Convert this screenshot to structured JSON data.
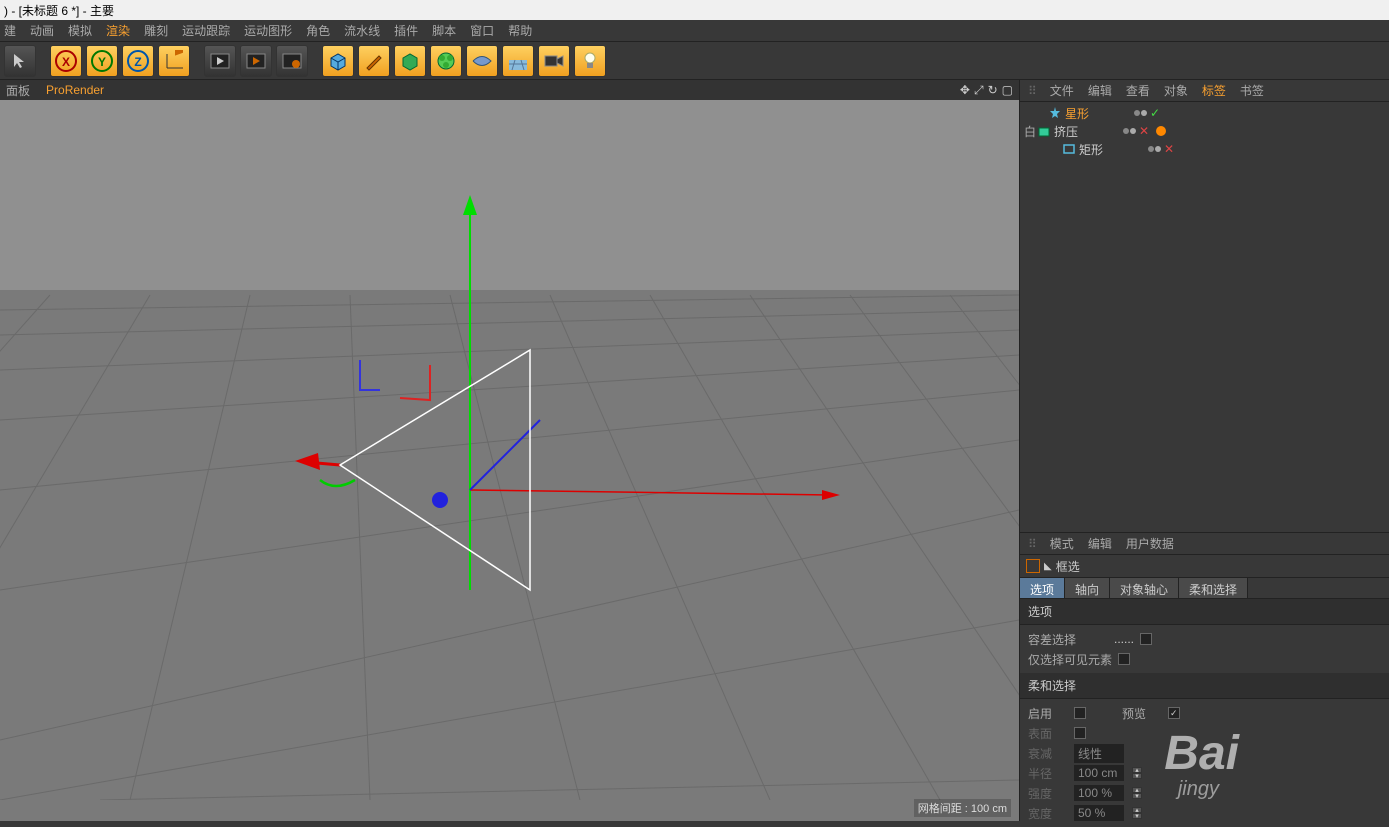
{
  "title": ") - [未标题 6 *] - 主要",
  "menu": [
    "建",
    "动画",
    "模拟",
    "渲染",
    "雕刻",
    "运动跟踪",
    "运动图形",
    "角色",
    "流水线",
    "插件",
    "脚本",
    "窗口",
    "帮助"
  ],
  "menu_hl": 3,
  "vphdr": {
    "panel": "面板",
    "pro": "ProRender"
  },
  "vpstatus": "网格间距 : 100 cm",
  "objmgr": {
    "menu": [
      "文件",
      "编辑",
      "查看",
      "对象",
      "标签",
      "书签"
    ],
    "menu_hl": 4,
    "rows": [
      {
        "indent": 0,
        "exp": "",
        "icon": "star",
        "name": "星形",
        "sel": true,
        "state": "ok",
        "tag": false
      },
      {
        "indent": 0,
        "exp": "白",
        "icon": "extrude",
        "name": "挤压",
        "sel": false,
        "state": "x",
        "tag": true
      },
      {
        "indent": 1,
        "exp": "",
        "icon": "rect",
        "name": "矩形",
        "sel": false,
        "state": "x",
        "tag": false
      }
    ]
  },
  "attrmgr": {
    "menu": [
      "模式",
      "编辑",
      "用户数据"
    ],
    "tool": "框选",
    "tabs": [
      "选项",
      "轴向",
      "对象轴心",
      "柔和选择"
    ],
    "tab_active": 0,
    "sect1": "选项",
    "p_tolerance": "容差选择",
    "p_visible": "仅选择可见元素",
    "sect2": "柔和选择",
    "p_enable": "启用",
    "p_preview": "预览",
    "p_surface": "表面",
    "p_falloff": "衰减",
    "p_falloff_v": "线性",
    "p_radius": "半径",
    "p_radius_v": "100 cm",
    "p_strength": "强度",
    "p_strength_v": "100 %",
    "p_width": "宽度",
    "p_width_v": "50 %"
  },
  "watermark1": "Bai",
  "watermark2": "jingy"
}
